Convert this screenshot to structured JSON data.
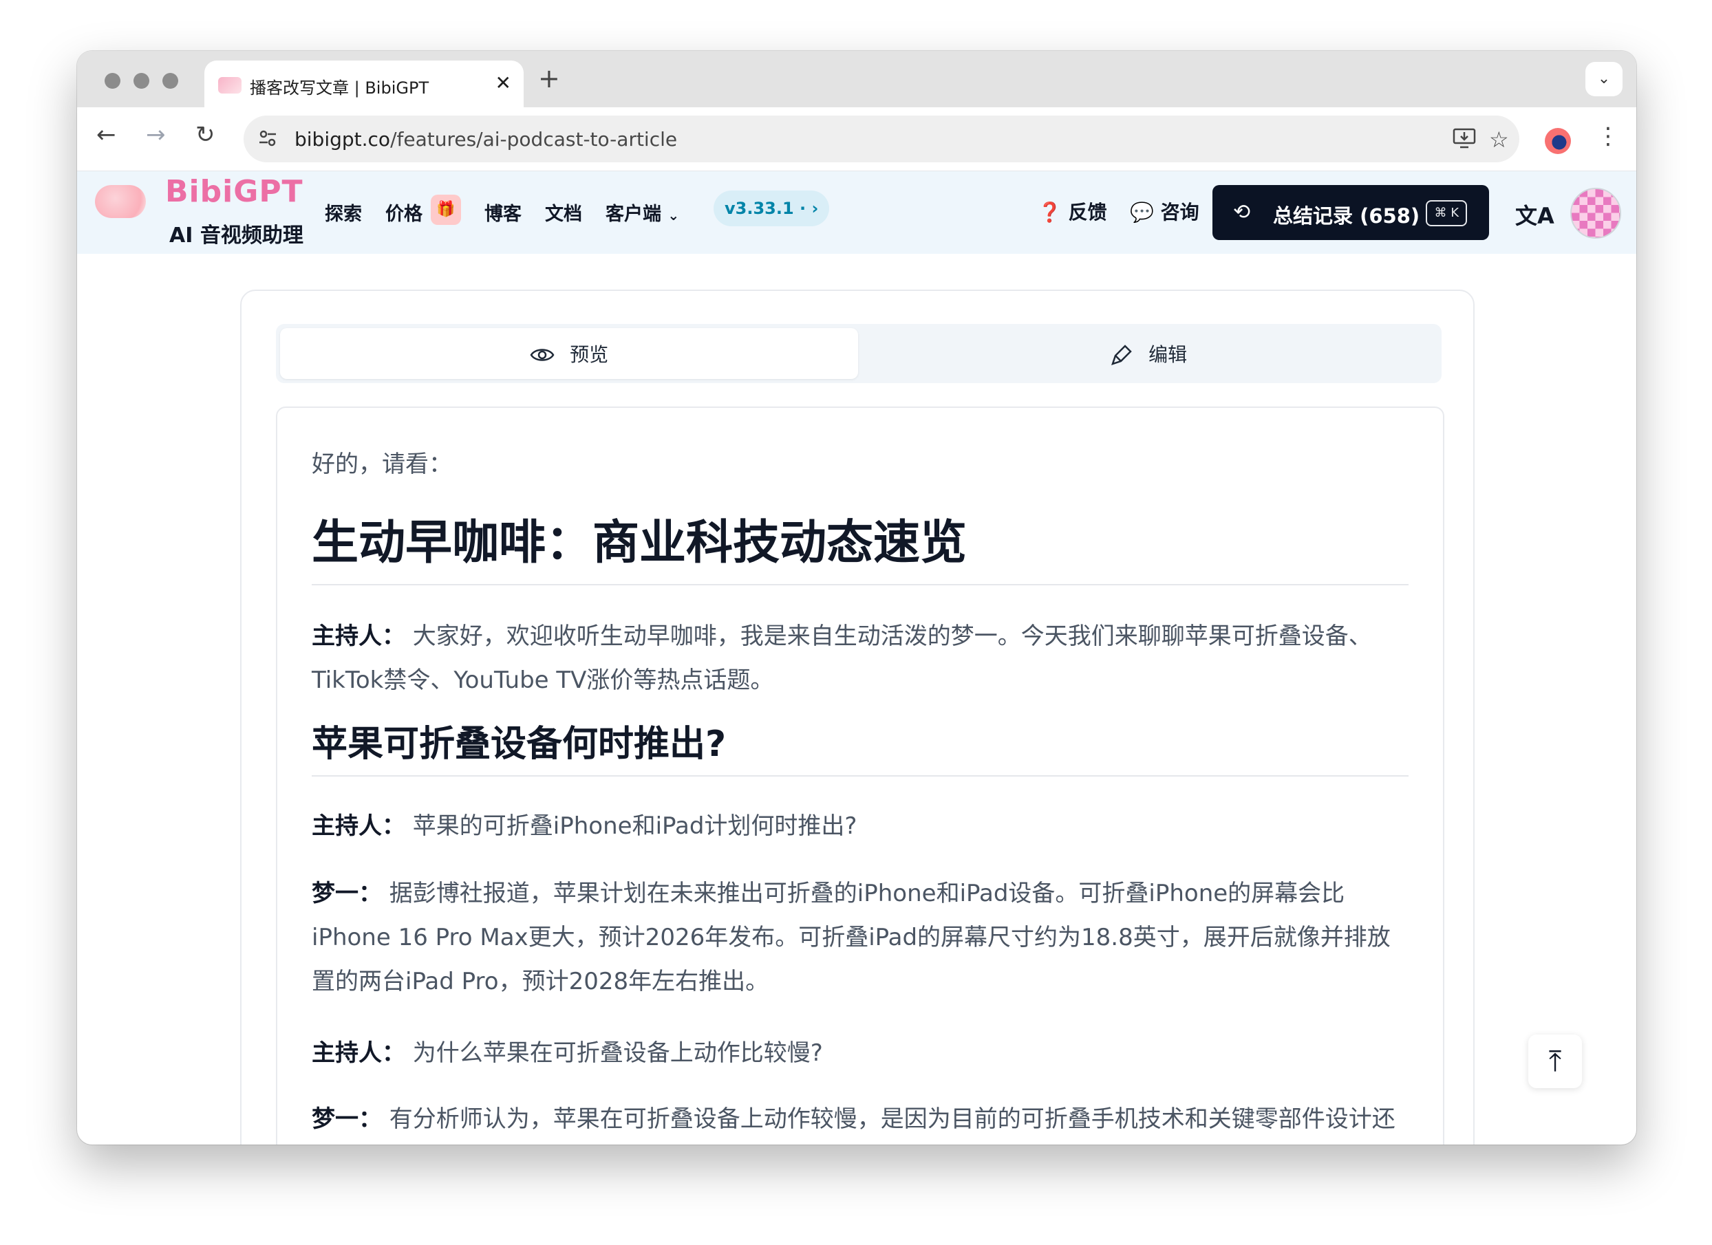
{
  "browser": {
    "tab_title": "播客改写文章 | BibiGPT",
    "tab_close": "✕",
    "new_tab": "+",
    "tabs_menu": "⌄",
    "url_domain": "bibigpt.co",
    "url_path": "/features/ai-podcast-to-article"
  },
  "site": {
    "brand": "BibiGPT",
    "tagline": "AI 音视频助理",
    "nav": [
      "探索",
      "价格",
      "博客",
      "文档",
      "客户端"
    ],
    "version": "v3.33.1 · ›",
    "feedback": "反馈",
    "consult": "咨询",
    "history": "总结记录 (658)",
    "history_shortcut": "⌘ K"
  },
  "tabs": {
    "preview": "预览",
    "edit": "编辑"
  },
  "article": {
    "intro": "好的，请看：",
    "title": "生动早咖啡：商业科技动态速览",
    "p1_speaker": "主持人：",
    "p1_text": " 大家好，欢迎收听生动早咖啡，我是来自生动活泼的梦一。今天我们来聊聊苹果可折叠设备、TikTok禁令、YouTube TV涨价等热点话题。",
    "h2": "苹果可折叠设备何时推出?",
    "p2_speaker": "主持人：",
    "p2_text": " 苹果的可折叠iPhone和iPad计划何时推出?",
    "p3_speaker": "梦一：",
    "p3_text": " 据彭博社报道，苹果计划在未来推出可折叠的iPhone和iPad设备。可折叠iPhone的屏幕会比iPhone 16 Pro Max更大，预计2026年发布。可折叠iPad的屏幕尺寸约为18.8英寸，展开后就像并排放置的两台iPad Pro，预计2028年左右推出。",
    "p4_speaker": "主持人：",
    "p4_text": " 为什么苹果在可折叠设备上动作比较慢?",
    "p5_speaker": "梦一：",
    "p5_text": " 有分析师认为，苹果在可折叠设备上动作较慢，是因为目前的可折叠手机技术和关键零部件设计还不够成熟。华尔街日报指出，苹果迫切希望找到新的增长途径，而新的硬件设计是苹果销售增"
  },
  "icons": {
    "back": "back-arrow-icon",
    "forward": "forward-arrow-icon",
    "reload": "reload-icon",
    "site_info": "tune-icon",
    "install": "install-app-icon",
    "bookmark": "star-icon",
    "menu": "more-vert-icon",
    "eye": "eye-icon",
    "pen": "pen-icon",
    "ear": "ear-icon",
    "wechat": "wechat-icon",
    "history": "history-icon",
    "translate": "translate-icon",
    "to_top": "arrow-to-top-icon"
  },
  "colors": {
    "brand_pink": "#ec6fa5",
    "header_bg": "#eef6fc",
    "history_btn_bg": "#0b1324",
    "version_text": "#0284a8"
  }
}
